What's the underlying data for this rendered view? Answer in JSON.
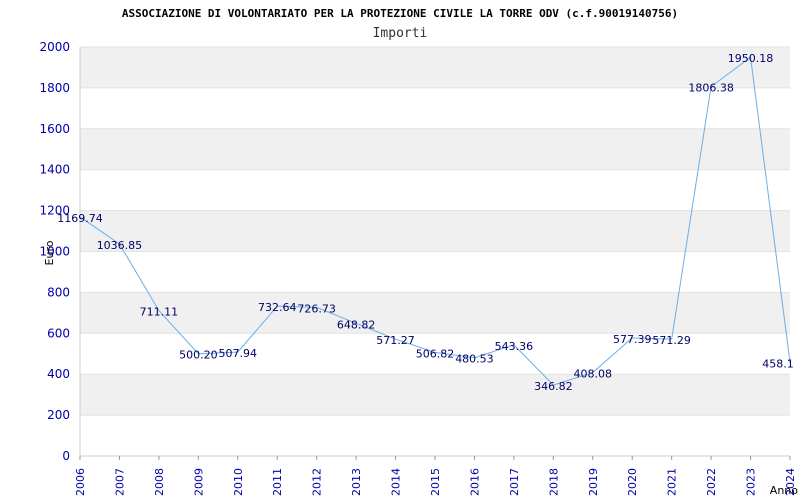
{
  "chart_data": {
    "type": "line",
    "title": "ASSOCIAZIONE DI VOLONTARIATO PER LA PROTEZIONE CIVILE LA TORRE ODV (c.f.90019140756)",
    "subtitle": "Importi",
    "xlabel": "Anno",
    "ylabel": "Euro",
    "ylim": [
      0,
      2000
    ],
    "yticks": [
      0,
      200,
      400,
      600,
      800,
      1000,
      1200,
      1400,
      1600,
      1800,
      2000
    ],
    "grid": "horizontal bands",
    "x": [
      "2006",
      "2007",
      "2008",
      "2009",
      "2010",
      "2011",
      "2012",
      "2013",
      "2014",
      "2015",
      "2016",
      "2017",
      "2018",
      "2019",
      "2020",
      "2021",
      "2022",
      "2023",
      "2024"
    ],
    "values": [
      1169.74,
      1036.85,
      711.11,
      500.2,
      507.94,
      732.64,
      726.73,
      648.82,
      571.27,
      506.82,
      480.53,
      543.36,
      346.82,
      408.08,
      577.39,
      571.29,
      1806.38,
      1950.18,
      458.1
    ],
    "labels": [
      "1169.74",
      "1036.85",
      "711.11",
      "500.20",
      "507.94",
      "732.64",
      "726.73",
      "648.82",
      "571.27",
      "506.82",
      "480.53",
      "543.36",
      "346.82",
      "408.08",
      "577.39",
      "571.29",
      "1806.38",
      "1950.18",
      "458.1"
    ],
    "colors": {
      "line": "#6aaee8",
      "band": "#f0f0f0",
      "tick_text": "#0000aa",
      "label_text": "#000066"
    }
  }
}
